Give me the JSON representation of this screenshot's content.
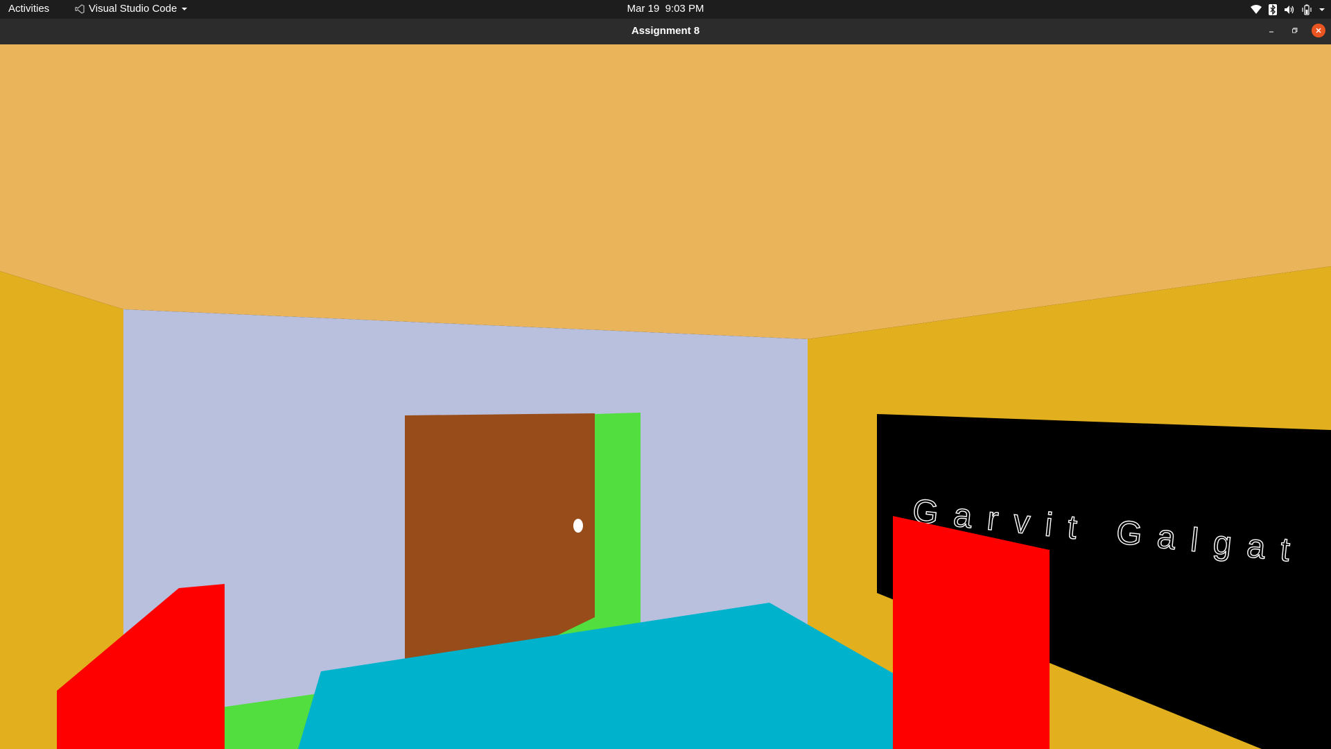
{
  "topbar": {
    "activities": "Activities",
    "app_name": "Visual Studio Code",
    "date": "Mar 19",
    "time": "9:03 PM"
  },
  "window": {
    "title": "Assignment 8"
  },
  "scene": {
    "board_text": "Garvit Galgat",
    "colors": {
      "ceiling": "#EAB45A",
      "side_walls": "#E2B01E",
      "back_wall": "#B8C0DD",
      "door": "#984C1A",
      "doorway": "#52DE3E",
      "floor": "#52DE3E",
      "table": "#00B2CC",
      "chairs": "#FF0000",
      "board": "#000000",
      "board_text": "#FFFFFF",
      "door_knob": "#FFFFFF"
    }
  },
  "icons": [
    "vscode-icon",
    "dropdown-arrow-icon",
    "wifi-icon",
    "bluetooth-icon",
    "volume-icon",
    "battery-icon",
    "system-menu-arrow-icon",
    "minimize-icon",
    "maximize-icon",
    "close-icon"
  ]
}
